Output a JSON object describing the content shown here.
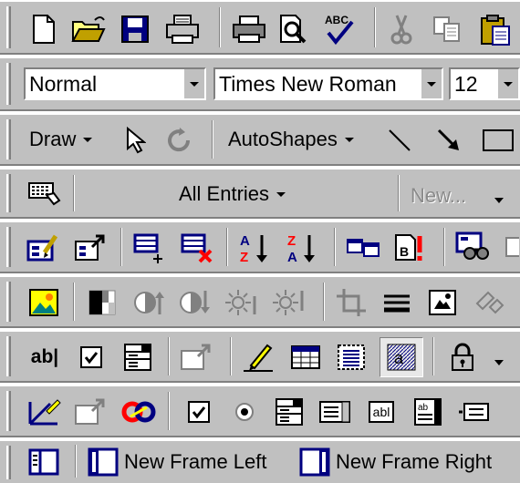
{
  "formatting": {
    "style": "Normal",
    "font": "Times New Roman",
    "size": "12"
  },
  "drawing": {
    "draw_label": "Draw",
    "autoshapes_label": "AutoShapes"
  },
  "autotext": {
    "all_entries_label": "All Entries",
    "new_label": "New..."
  },
  "forms": {
    "textfield_label": "ab|"
  },
  "frames": {
    "new_left_label": "New Frame Left",
    "new_right_label": "New Frame Right"
  },
  "web_tools": {
    "textbox_label": "abl"
  },
  "colors": {
    "toolbar_bg": "#c0c0c0",
    "navy": "#000080",
    "yellow": "#ffff00",
    "red": "#ff0000"
  }
}
